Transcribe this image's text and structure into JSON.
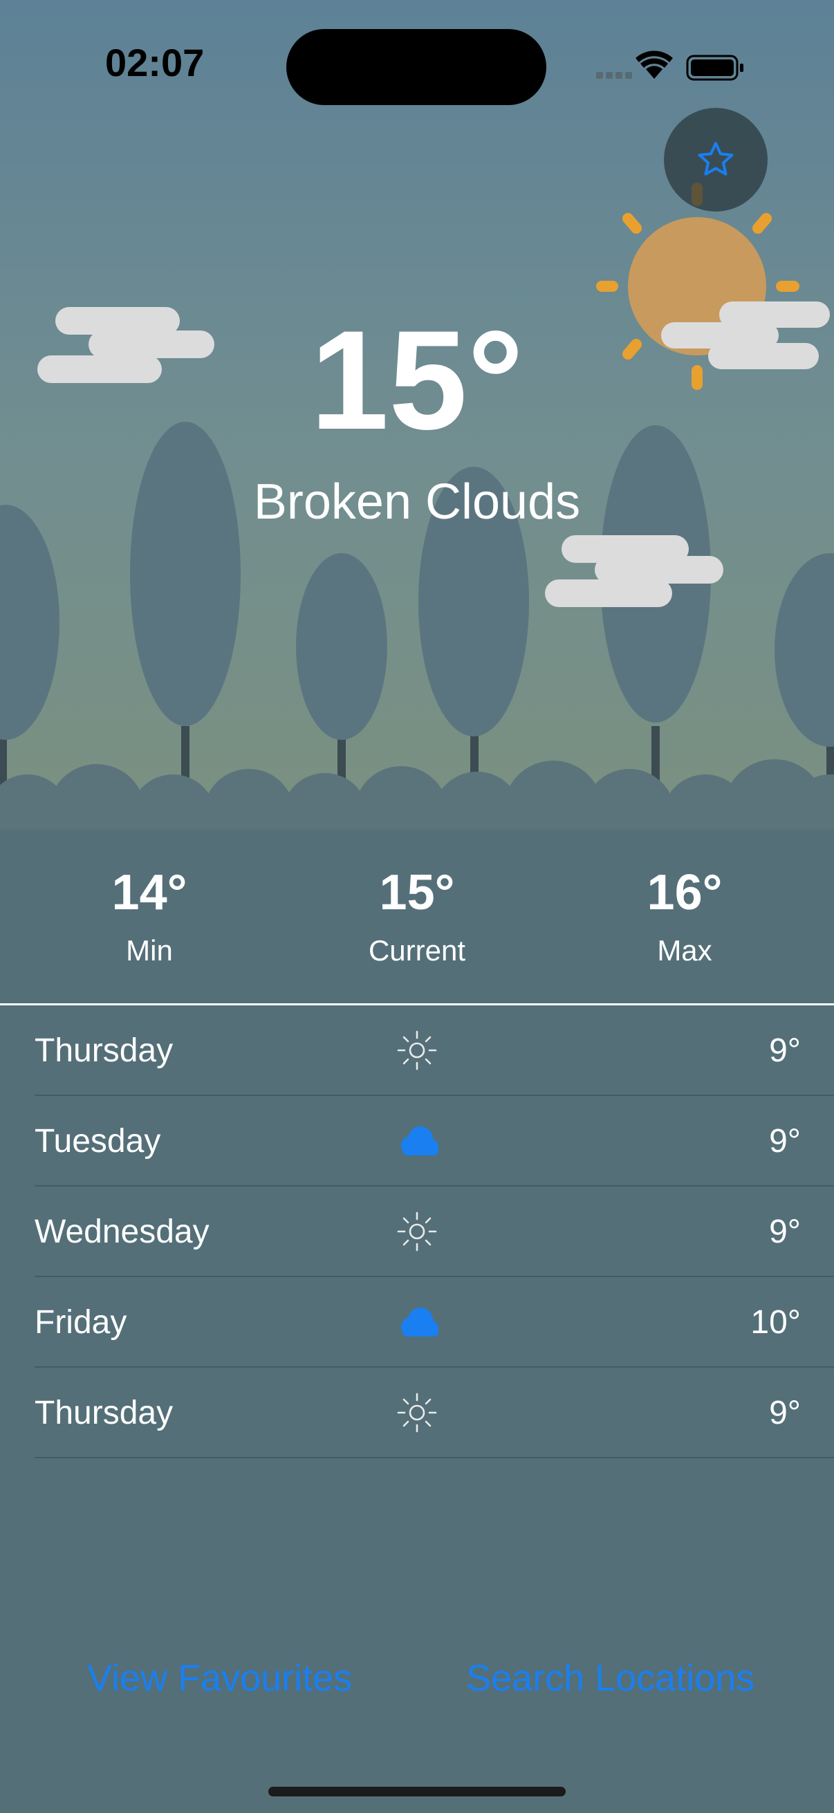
{
  "status_bar": {
    "time": "02:07"
  },
  "current": {
    "temperature": "15°",
    "condition": "Broken Clouds"
  },
  "stats": [
    {
      "value": "14°",
      "label": "Min"
    },
    {
      "value": "15°",
      "label": "Current"
    },
    {
      "value": "16°",
      "label": "Max"
    }
  ],
  "forecast": [
    {
      "day": "Thursday",
      "icon": "sun-icon",
      "temp": "9°"
    },
    {
      "day": "Tuesday",
      "icon": "cloud-icon",
      "temp": "9°"
    },
    {
      "day": "Wednesday",
      "icon": "sun-icon",
      "temp": "9°"
    },
    {
      "day": "Friday",
      "icon": "cloud-icon",
      "temp": "10°"
    },
    {
      "day": "Thursday",
      "icon": "sun-icon",
      "temp": "9°"
    }
  ],
  "links": {
    "favourites": "View Favourites",
    "search": "Search Locations"
  },
  "colors": {
    "background": "#546f78",
    "accent": "#1a7ff0",
    "sun": "#e8a030"
  }
}
